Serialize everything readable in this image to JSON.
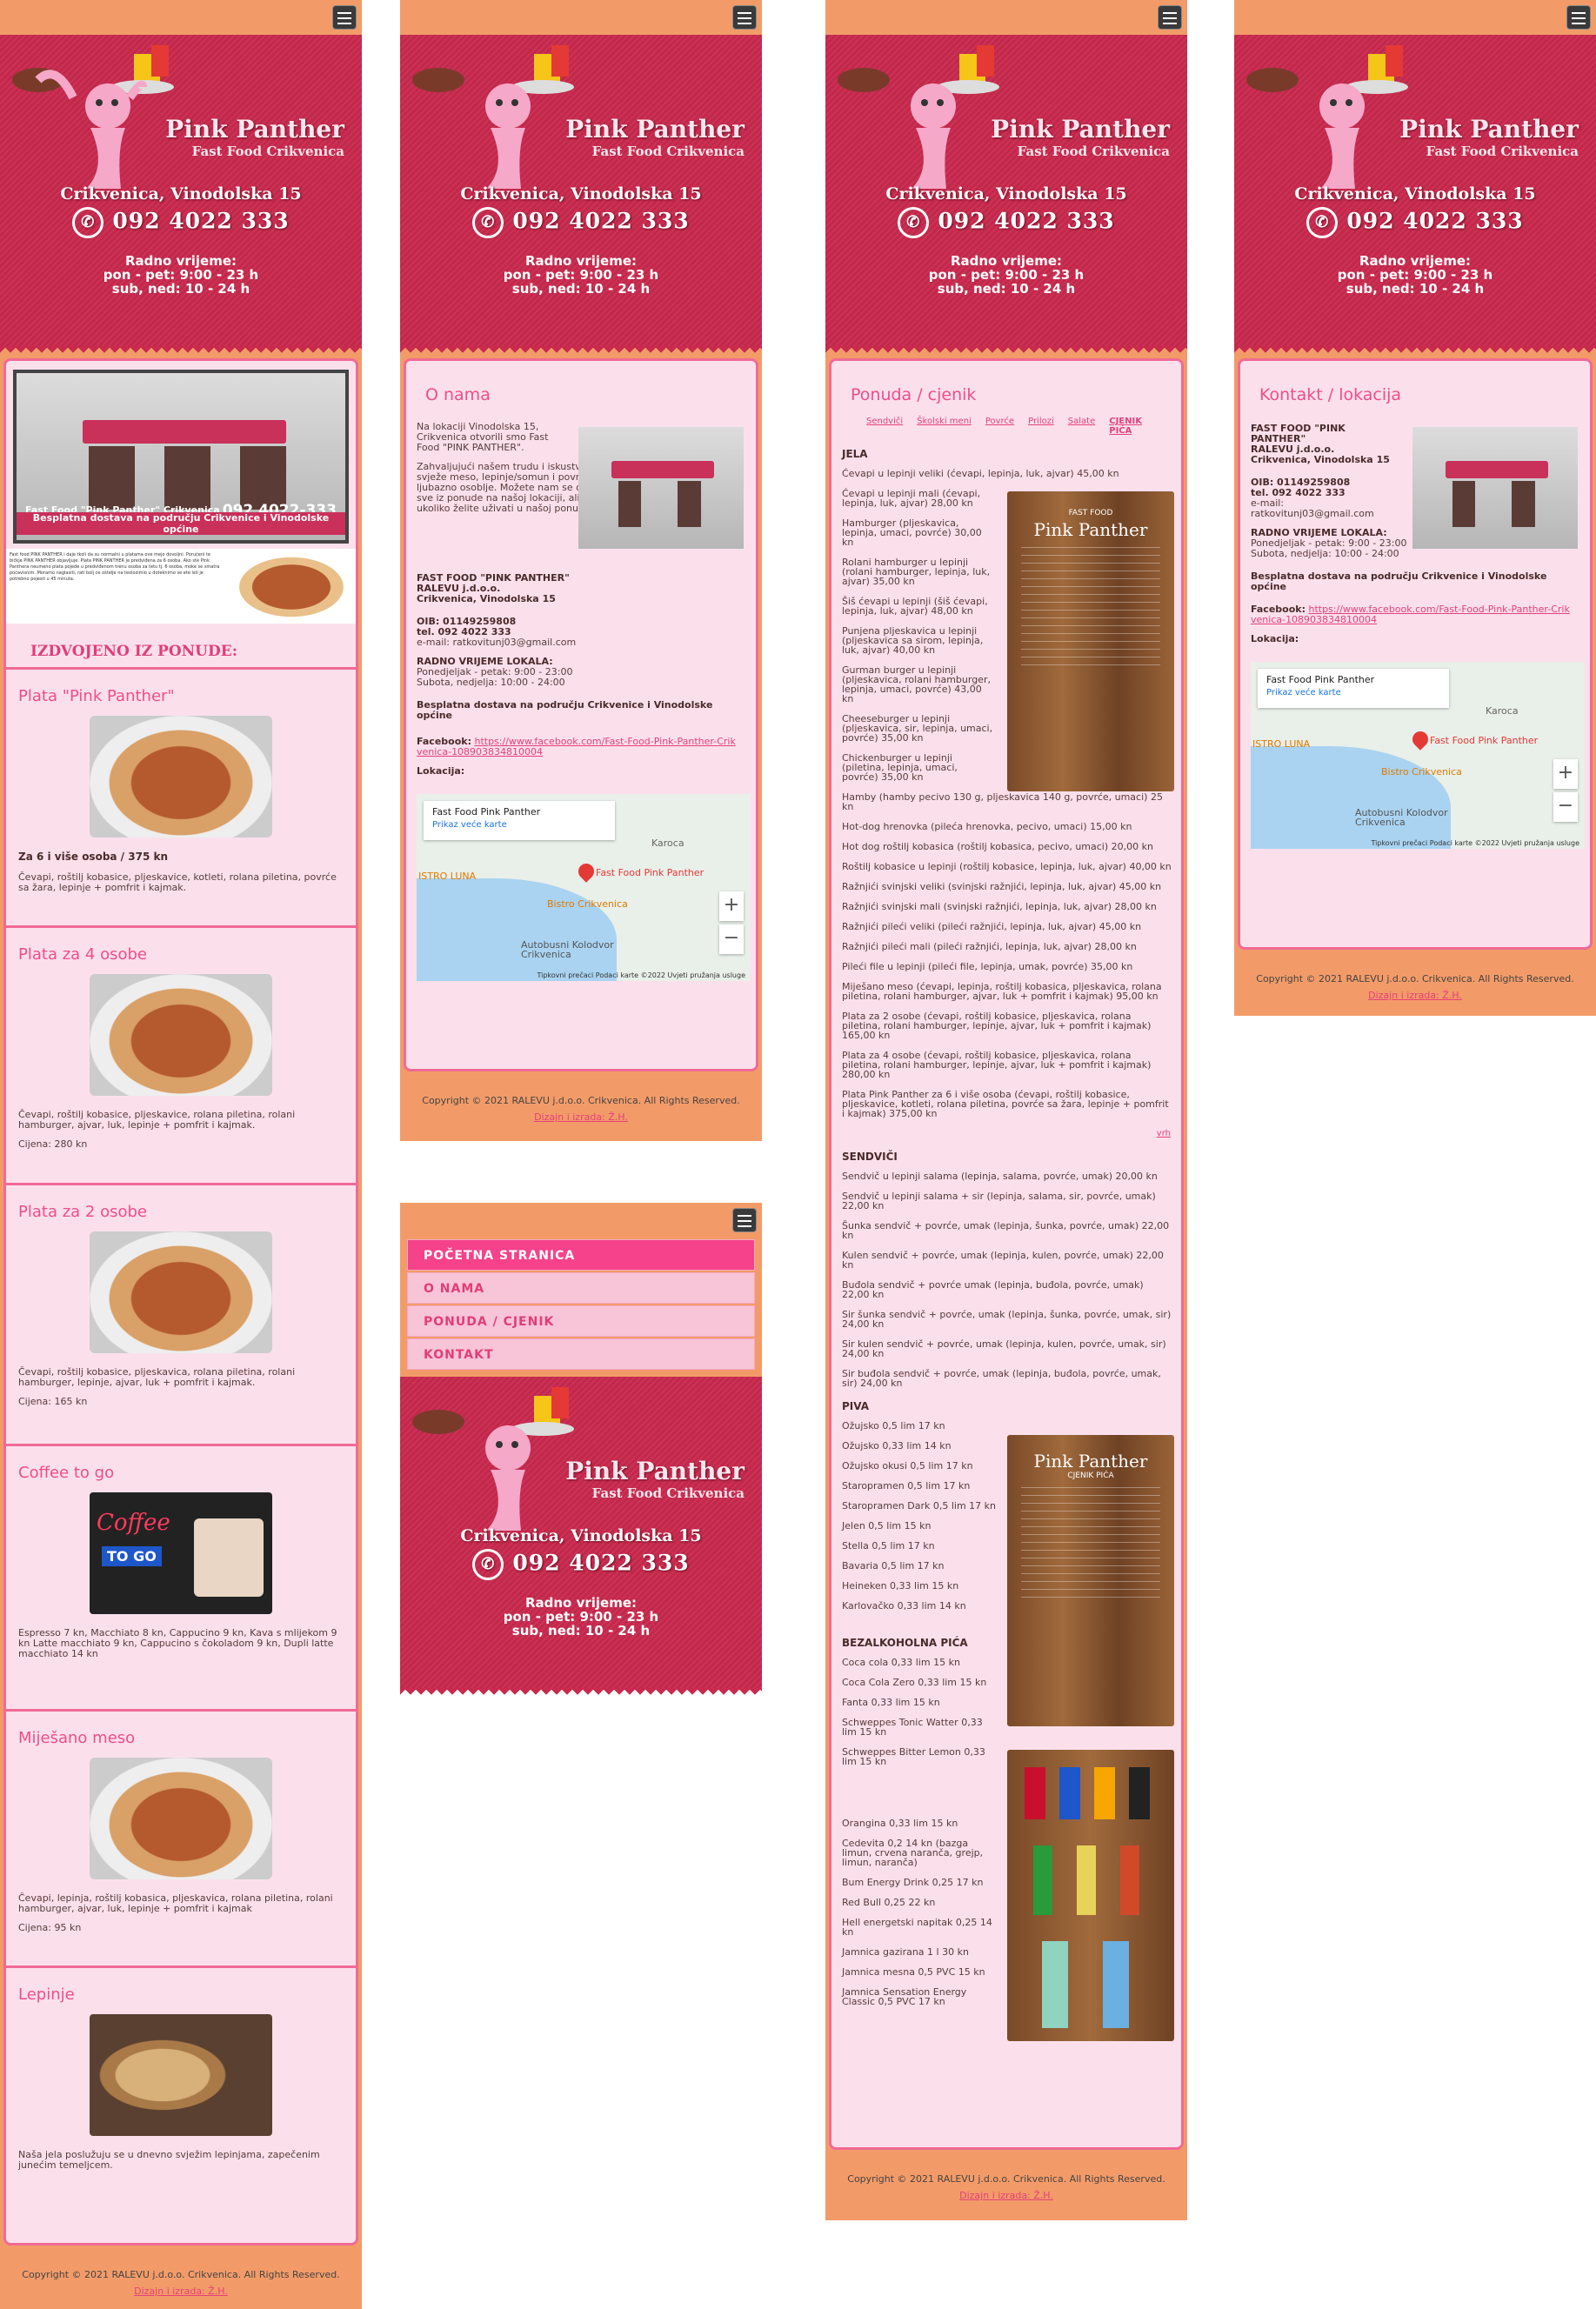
{
  "site": {
    "brand_title": "Pink Panther",
    "brand_subtitle": "Fast Food Crikvenica",
    "address": "Crikvenica, Vinodolska 15",
    "phone": "092 4022 333",
    "hours_title": "Radno vrijeme:",
    "hours_weekday": "pon - pet: 9:00 - 23 h",
    "hours_weekend": "sub, ned: 10 - 24 h",
    "copyright": "Copyright © 2021 RALEVU j.d.o.o. Crikvenica. All Rights Reserved.",
    "design": "Dizajn i izrada: Ž.H."
  },
  "nav": {
    "items": [
      "POČETNA STRANICA",
      "O NAMA",
      "PONUDA / CJENIK",
      "KONTAKT"
    ]
  },
  "home": {
    "banner_caption": "Fast Food \"Pink Panther\" Crikvenica",
    "banner_phone": "092 4022-333",
    "banner_delivery": "Besplatna dostava na području Crikvenice i Vinodolske općine",
    "promo_text": "Fast food PINK PANTHER i daje tkoli da su normalni u platama ove mejo dovoljni. Poručeni te bičkje PINK PANTHER objavljuje. Plata PINK PANTHER je predviđena za 6 osoba. Ako ste Pink Panthera neumeno plata pojede u predviđenom trenu osoba za tetu tj. 6 osoba, moke se smatra poćavisnim. Moramo naglasiti, rati bolj ce oštelje na teolozimio u doteknimo se ete isti je potrebno pojesti u 45 minuta.",
    "featured_heading": "IZDVOJENO IZ PONUDE:",
    "items": [
      {
        "title": "Plata \"Pink Panther\"",
        "line1": "Za 6 i više osoba  /  375 kn",
        "desc": "Čevapi, roštilj kobasice, pljeskavice, kotleti, rolana piletina, povrće sa žara, lepinje + pomfrit i kajmak.",
        "price": ""
      },
      {
        "title": "Plata za 4 osobe",
        "line1": "",
        "desc": "Čevapi, roštilj kobasice, pljeskavice, rolana piletina, rolani hamburger, ajvar, luk, lepinje + pomfrit i kajmak.",
        "price": "Cijena: 280 kn"
      },
      {
        "title": "Plata za 2 osobe",
        "line1": "",
        "desc": "Čevapi, roštilj kobasice, pljeskavica, rolana piletina, rolani hamburger, lepinje, ajvar, luk + pomfrit i kajmak.",
        "price": "Cijena: 165 kn"
      },
      {
        "title": "Coffee to go",
        "line1": "",
        "desc": "Espresso 7 kn, Macchiato 8 kn, Cappucino 9 kn, Kava s mlijekom 9 kn Latte macchiato 9 kn, Cappucino s čokoladom 9 kn, Dupli latte macchiato 14 kn",
        "price": ""
      },
      {
        "title": "Miješano meso",
        "line1": "",
        "desc": "Čevapi, lepinja, roštilj kobasica, pljeskavica, rolana piletina, rolani hamburger, ajvar, luk, lepinje + pomfrit i kajmak",
        "price": "Cijena: 95 kn"
      },
      {
        "title": "Lepinje",
        "line1": "",
        "desc": "Naša jela poslužuju se u dnevno svježim lepinjama, zapečenim junećim temeljcem.",
        "price": ""
      }
    ],
    "coffee_sign": "Coffee",
    "coffee_sign2": "TO GO"
  },
  "about": {
    "heading": "O nama",
    "intro": "Na lokaciji Vinodolska 15, Crikvenica otvorili smo Fast Food \"PINK PANTHER\".",
    "body": "Zahvaljujući našem trudu i iskustvu u ponudi imamo, uz dnevno svježe meso, lepinje/somun i povrće - kvalitetnu ponudu uz ljubazno osoblje. Možete nam se obratiti s povjerenjem te probati sve iz ponude na našoj lokaciji, ali i uvjeriti se u brzu dostavu, ukoliko želite uživati u našoj ponudi na Vašoj kućnoj adresi.",
    "company": "FAST FOOD \"PINK PANTHER\"",
    "company2": "RALEVU j.d.o.o.",
    "company3": "Crikvenica, Vinodolska 15",
    "oib": "OIB: 01149259808",
    "tel": "tel. 092 4022 333",
    "email": "e-mail: ratkovitunj03@gmail.com",
    "hours_title": "RADNO VRIJEME LOKALA:",
    "hours1": "Ponedjeljak - petak: 9:00 - 23:00",
    "hours2": "Subota, nedjelja: 10:00 - 24:00",
    "delivery": "Besplatna dostava na području Crikvenice i Vinodolske općine",
    "facebook_label": "Facebook:",
    "facebook_url": "https://www.facebook.com/Fast-Food-Pink-Panther-Crikvenica-108903834810004",
    "location_label": "Lokacija:"
  },
  "map": {
    "place": "Fast Food Pink Panther",
    "larger": "Prikaz veće karte",
    "marker": "Fast Food Pink Panther",
    "poi1": "ISTRO LUNA",
    "poi2": "Bistro Crikvenica",
    "poi3": "Karoca",
    "poi4": "Autobusni Kolodvor Crikvenica",
    "attr": "Tipkovni prečaci  Podaci karte ©2022  Uvjeti pružanja usluge",
    "zoom_in": "+",
    "zoom_out": "−"
  },
  "menu": {
    "heading": "Ponuda / cjenik",
    "tabs": [
      "Sendviči",
      "Školski meni",
      "Povrće",
      "Prilozi",
      "Salate",
      "CJENIK PIĆA"
    ],
    "board1_title": "Pink Panther",
    "board1_sub": "FAST FOOD",
    "board2_sub": "CJENIK PIĆA",
    "top_link": "vrh",
    "sections": [
      {
        "title": "JELA",
        "items": [
          "Ćevapi u lepinji veliki (ćevapi, lepinja, luk, ajvar)    45,00 kn",
          "Ćevapi u lepinji mali (ćevapi, lepinja, luk, ajvar)    28,00 kn",
          "Hamburger (pljeskavica, lepinja, umaci, povrće)    30,00 kn",
          "Rolani hamburger u lepinji (rolani hamburger, lepinja, luk, ajvar)    35,00 kn",
          "Šiš ćevapi u lepinji (šiš ćevapi, lepinja, luk, ajvar)    48,00 kn",
          "Punjena pljeskavica u lepinji (pljeskavica sa sirom, lepinja, luk, ajvar)    40,00 kn",
          "Gurman burger u lepinji (pljeskavica, rolani hamburger, lepinja, umaci, povrće)    43,00 kn",
          "Cheeseburger u lepinji (pljeskavica, sir, lepinja, umaci, povrće)    35,00 kn",
          "Chickenburger u lepinji (piletina, lepinja, umaci, povrće)    35,00 kn",
          "Hamby (hamby pecivo 130 g, pljeskavica 140 g, povrće, umaci)   25 kn",
          "Hot-dog hrenovka (pileća hrenovka, pecivo, umaci)    15,00 kn",
          "Hot dog roštilj kobasica (roštilj kobasica, pecivo, umaci)    20,00 kn",
          "Roštilj kobasice u lepinji (roštilj kobasice, lepinja, luk, ajvar)    40,00 kn",
          "Ražnjići svinjski veliki (svinjski ražnjići, lepinja, luk, ajvar)    45,00 kn",
          "Ražnjići svinjski mali (svinjski ražnjići, lepinja, luk, ajvar)    28,00 kn",
          "Ražnjići pileći veliki (pileći ražnjići, lepinja, luk, ajvar)    45,00 kn",
          "Ražnjići pileći mali (pileći ražnjići, lepinja, luk, ajvar)    28,00 kn",
          "Pileći file u lepinji (pileći file, lepinja, umak, povrće)    35,00 kn",
          "Miješano meso (ćevapi, lepinja, roštilj kobasica, pljeskavica, rolana piletina, rolani hamburger, ajvar, luk + pomfrit i kajmak)    95,00 kn",
          "Plata za 2 osobe (ćevapi, roštilj kobasice, pljeskavica, rolana piletina, rolani hamburger, lepinje, ajvar, luk + pomfrit i kajmak)    165,00 kn",
          "Plata za 4 osobe (ćevapi, roštilj kobasice, pljeskavica, rolana piletina, rolani hamburger, lepinje, ajvar, luk + pomfrit i kajmak)    280,00 kn",
          "Plata Pink Panther za 6 i više osoba (ćevapi, roštilj kobasice, pljeskavice, kotleti, rolana piletina, povrće sa žara, lepinje + pomfrit i kajmak)    375,00 kn"
        ]
      },
      {
        "title": "SENDVIČI",
        "items": [
          "Sendvič u lepinji salama (lepinja, salama, povrće, umak)    20,00 kn",
          "Sendvič u lepinji salama + sir (lepinja, salama, sir, povrće, umak)    22,00 kn",
          "Šunka sendvič + povrće, umak (lepinja, šunka, povrće, umak) 22,00 kn",
          "Kulen sendvič + povrće, umak (lepinja, kulen, povrće, umak) 22,00 kn",
          "Buđola sendvič + povrće umak (lepinja, buđola, povrće, umak) 22,00 kn",
          "Sir šunka sendvič + povrće, umak (lepinja, šunka, povrće, umak, sir) 24,00 kn",
          "Sir kulen sendvič + povrće, umak (lepinja, kulen, povrće, umak, sir) 24,00 kn",
          "Sir buđola sendvič + povrće, umak (lepinja, buđola, povrće, umak, sir) 24,00 kn"
        ]
      },
      {
        "title": "PIVA",
        "items": [
          "Ožujsko 0,5 lim    17 kn",
          "Ožujsko 0,33 lim    14 kn",
          "Ožujsko okusi 0,5 lim    17 kn",
          "Staropramen 0,5 lim    17 kn",
          "Staropramen Dark 0,5 lim    17 kn",
          "Jelen 0,5 lim    15 kn",
          "Stella 0,5 lim    17 kn",
          "Bavaria 0,5 lim    17 kn",
          "Heineken 0,33 lim    15 kn",
          "Karlovačko 0,33 lim    14 kn"
        ]
      },
      {
        "title": "BEZALKOHOLNA PIĆA",
        "items": [
          "Coca cola 0,33 lim    15 kn",
          "Coca Cola Zero 0,33 lim    15 kn",
          "Fanta 0,33 lim    15 kn",
          "Schweppes Tonic Watter 0,33 lim    15 kn",
          "Schweppes Bitter Lemon 0,33 lim    15 kn",
          "Orangina 0,33 lim    15 kn",
          "Cedevita 0,2    14 kn (bazga limun, crvena naranča, grejp, limun, naranča)",
          "Bum Energy Drink  0,25    17 kn",
          "Red Bull 0,25    22 kn",
          "Hell energetski napitak 0,25    14 kn",
          "Jamnica gazirana 1 l    30 kn",
          "Jamnica mesna 0,5 PVC    15 kn",
          "Jamnica Sensation Energy Classic 0,5 PVC    17 kn"
        ]
      }
    ]
  },
  "contact": {
    "heading": "Kontakt / lokacija",
    "company": "FAST FOOD \"PINK PANTHER\"",
    "company2": "RALEVU j.d.o.o.",
    "company3": "Crikvenica, Vinodolska 15",
    "oib": "OIB: 01149259808",
    "tel": "tel. 092 4022 333",
    "email": "e-mail: ratkovitunj03@gmail.com",
    "hours_title": "RADNO VRIJEME LOKALA:",
    "hours1": "Ponedjeljak - petak: 9:00 - 23:00",
    "hours2": "Subota, nedjelja: 10:00 - 24:00",
    "delivery": "Besplatna dostava na području Crikvenice i Vinodolske općine",
    "facebook_label": "Facebook:",
    "facebook_url": "https://www.facebook.com/Fast-Food-Pink-Panther-Crikvenica-108903834810004",
    "location_label": "Lokacija:"
  },
  "colors": {
    "accent": "#f04d88",
    "header": "#c92a4e",
    "page_bg": "#f39b68",
    "panel": "#fbe0ec"
  }
}
